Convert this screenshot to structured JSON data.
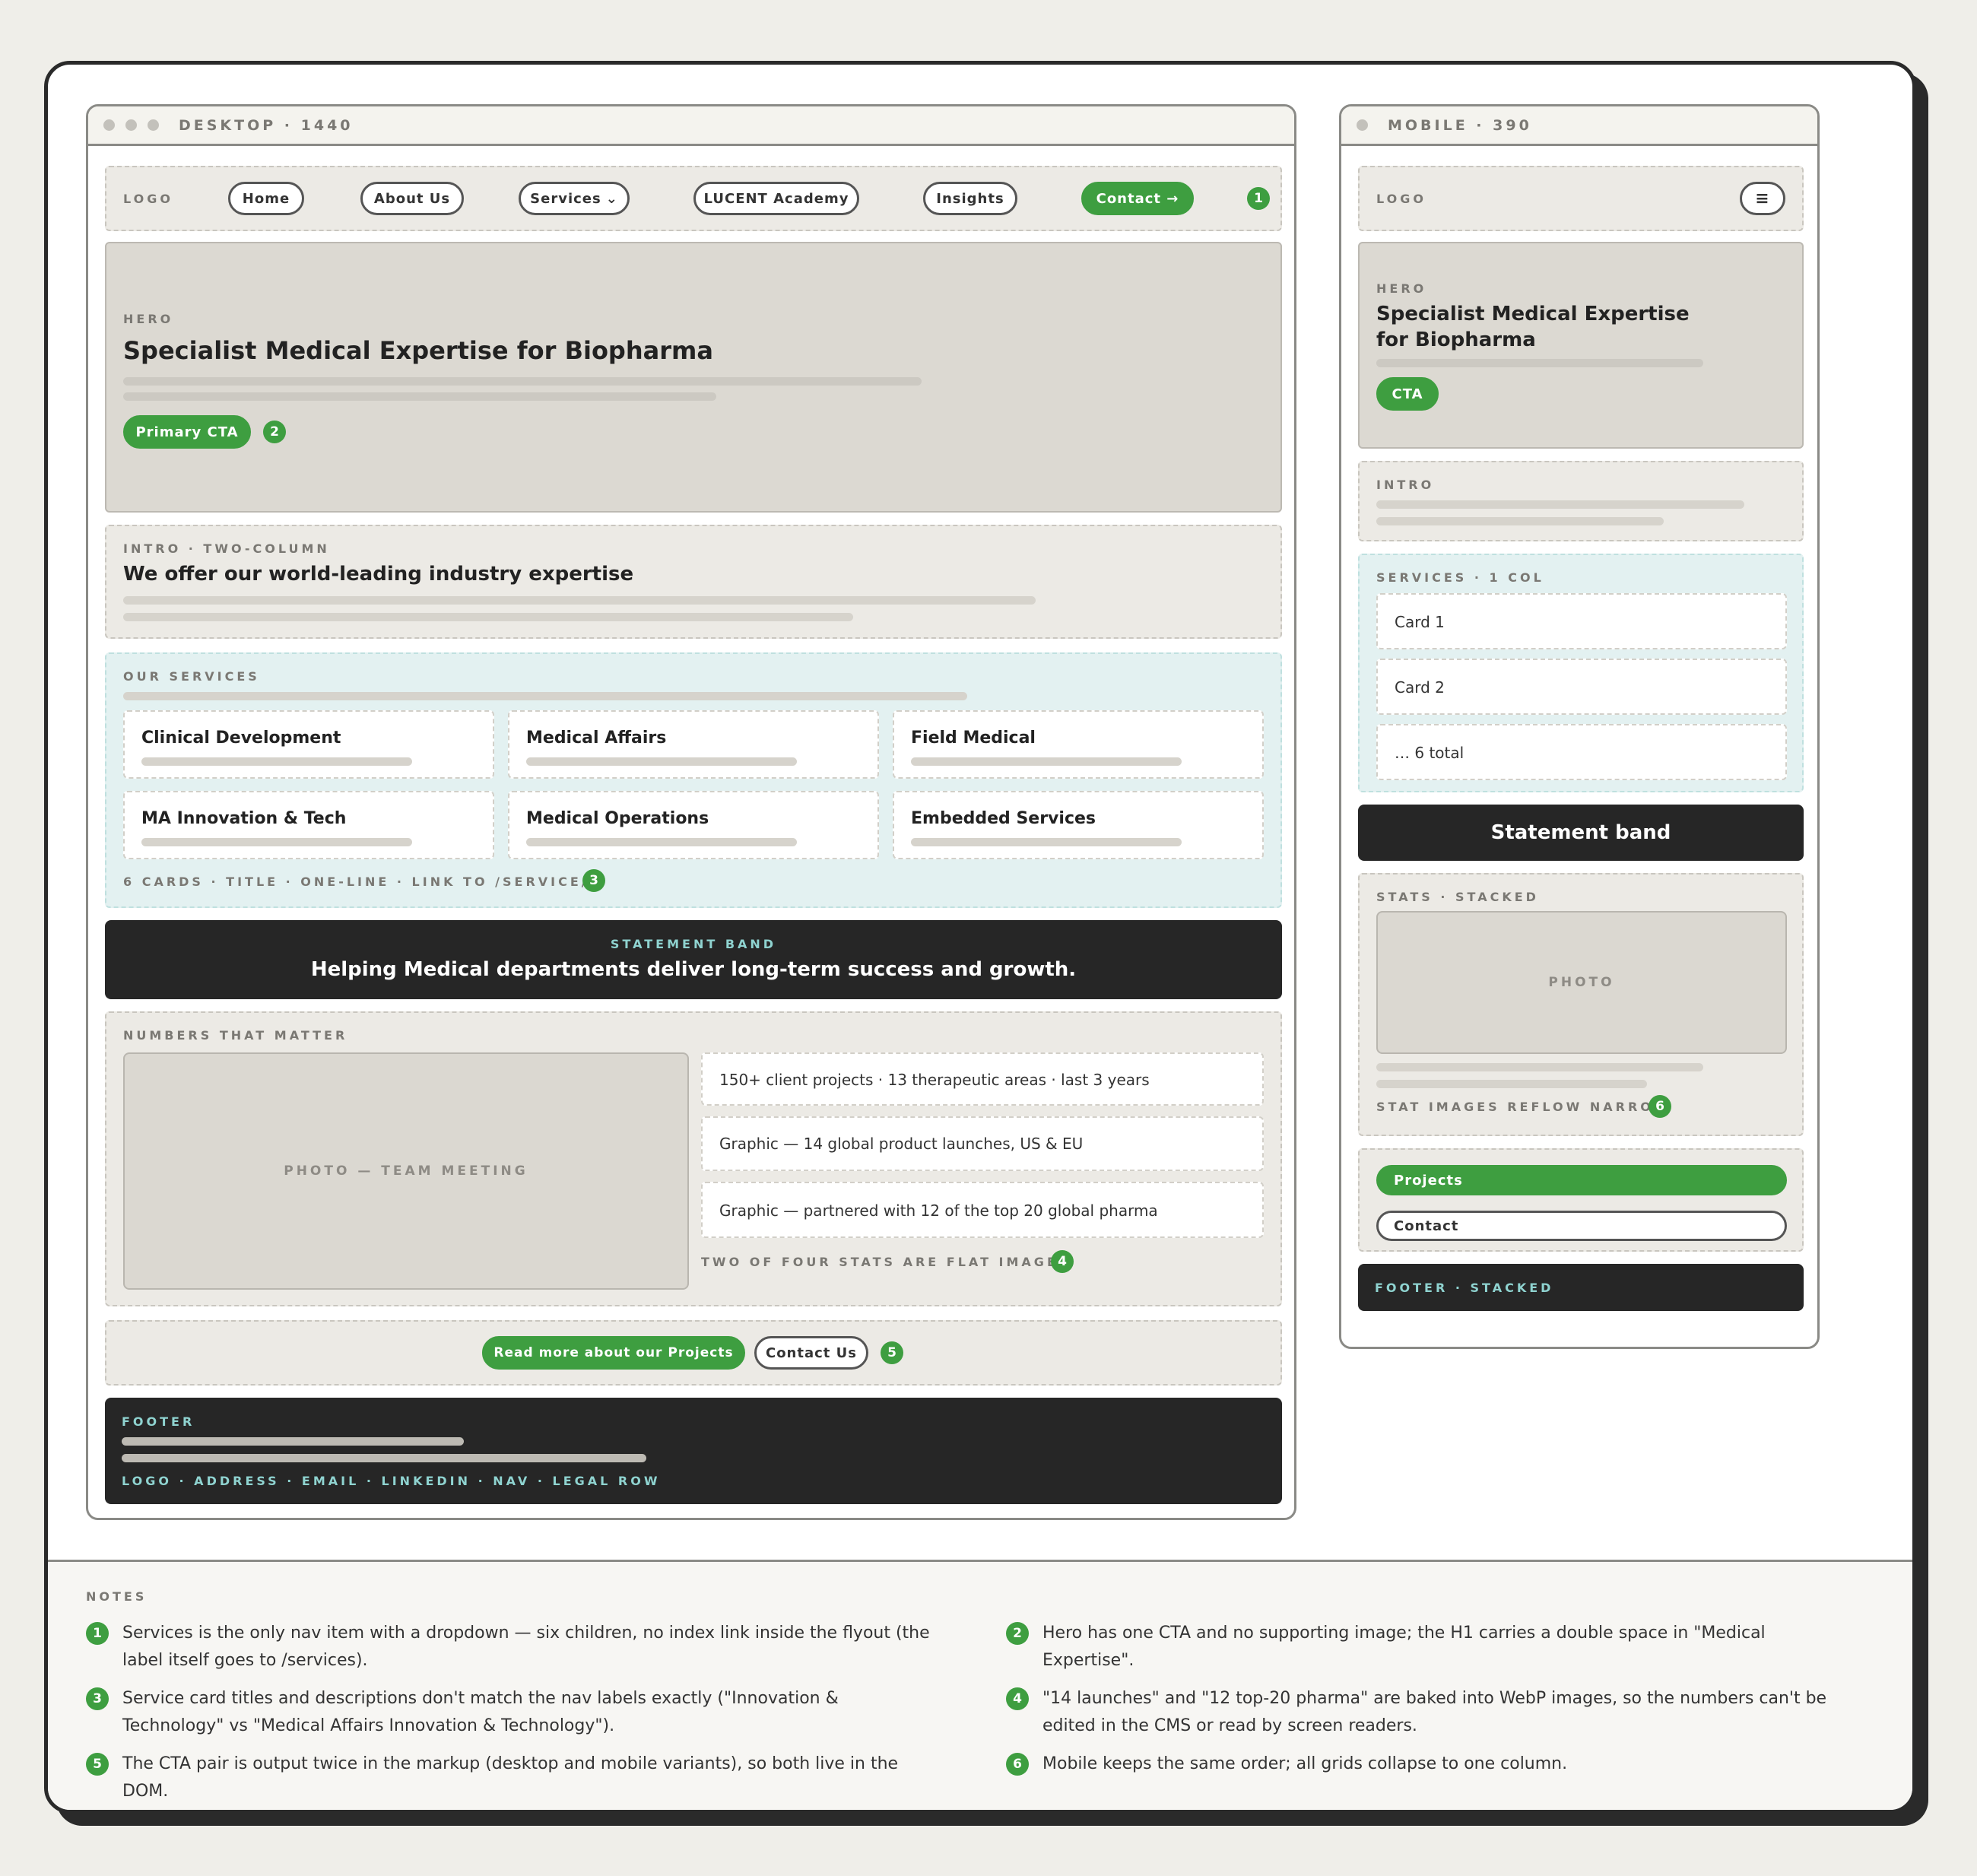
{
  "desktop": {
    "chrome_label": "DESKTOP · 1440",
    "nav": {
      "logo": "LOGO",
      "items": [
        "Home",
        "About Us",
        "Services",
        "LUCENT Academy",
        "Insights"
      ],
      "dropdown_glyph": "⌄",
      "contact": "Contact →",
      "marker": "1"
    },
    "hero": {
      "label": "HERO",
      "title": "Specialist Medical Expertise for Biopharma",
      "cta": "Primary CTA",
      "marker": "2"
    },
    "intro": {
      "label": "INTRO · TWO-COLUMN",
      "title": "We offer our world-leading industry expertise"
    },
    "services": {
      "label": "OUR SERVICES",
      "cards": [
        "Clinical Development",
        "Medical Affairs",
        "Field Medical",
        "MA Innovation & Tech",
        "Medical Operations",
        "Embedded Services"
      ],
      "footnote": "6 CARDS · TITLE · ONE-LINE · LINK TO /SERVICE/…",
      "marker": "3"
    },
    "statement": {
      "label": "STATEMENT BAND",
      "text": "Helping Medical departments deliver long-term success and growth."
    },
    "numbers": {
      "label": "NUMBERS THAT MATTER",
      "photo": "PHOTO — TEAM MEETING",
      "stats": [
        "150+ client projects · 13 therapeutic areas · last 3 years",
        "Graphic — 14 global product launches, US & EU",
        "Graphic — partnered with 12 of the top 20 global pharma"
      ],
      "footnote": "TWO OF FOUR STATS ARE FLAT IMAGES",
      "marker": "4"
    },
    "cta": {
      "primary": "Read more about our Projects",
      "secondary": "Contact Us",
      "marker": "5"
    },
    "footer": {
      "label": "FOOTER",
      "row": "LOGO · ADDRESS · EMAIL · LINKEDIN · NAV · LEGAL ROW"
    }
  },
  "mobile": {
    "chrome_label": "MOBILE · 390",
    "logo": "LOGO",
    "menu_glyph": "≡",
    "hero": {
      "label": "HERO",
      "title_line1": "Specialist Medical Expertise",
      "title_line2": "for Biopharma",
      "cta": "CTA"
    },
    "intro": {
      "label": "INTRO"
    },
    "services": {
      "label": "SERVICES · 1 COL",
      "cards": [
        "Card 1",
        "Card 2",
        "… 6 total"
      ]
    },
    "statement": "Statement band",
    "stats": {
      "label": "STATS · STACKED",
      "photo": "PHOTO",
      "footnote": "STAT IMAGES REFLOW NARROW",
      "marker": "6"
    },
    "cta": {
      "primary": "Projects",
      "secondary": "Contact"
    },
    "footer": "FOOTER · STACKED"
  },
  "notes": {
    "title": "NOTES",
    "items": [
      {
        "n": "1",
        "text": "Services is the only nav item with a dropdown — six children, no index link inside the flyout (the label itself goes to /services)."
      },
      {
        "n": "2",
        "text": "Hero has one CTA and no supporting image; the H1 carries a double space in \"Medical  Expertise\"."
      },
      {
        "n": "3",
        "text": "Service card titles and descriptions don't match the nav labels exactly (\"Innovation & Technology\" vs \"Medical Affairs Innovation & Technology\")."
      },
      {
        "n": "4",
        "text": "\"14 launches\" and \"12 top-20 pharma\" are baked into WebP images, so the numbers can't be edited in the CMS or read by screen readers."
      },
      {
        "n": "5",
        "text": "The CTA pair is output twice in the markup (desktop and mobile variants), so both live in the DOM."
      },
      {
        "n": "6",
        "text": "Mobile keeps the same order; all grids collapse to one column."
      }
    ]
  },
  "colors": {
    "accent": "#3e9e40",
    "dark": "#262626",
    "teal_label": "#8fd3d0",
    "services_bg": "#e3f1f1"
  }
}
